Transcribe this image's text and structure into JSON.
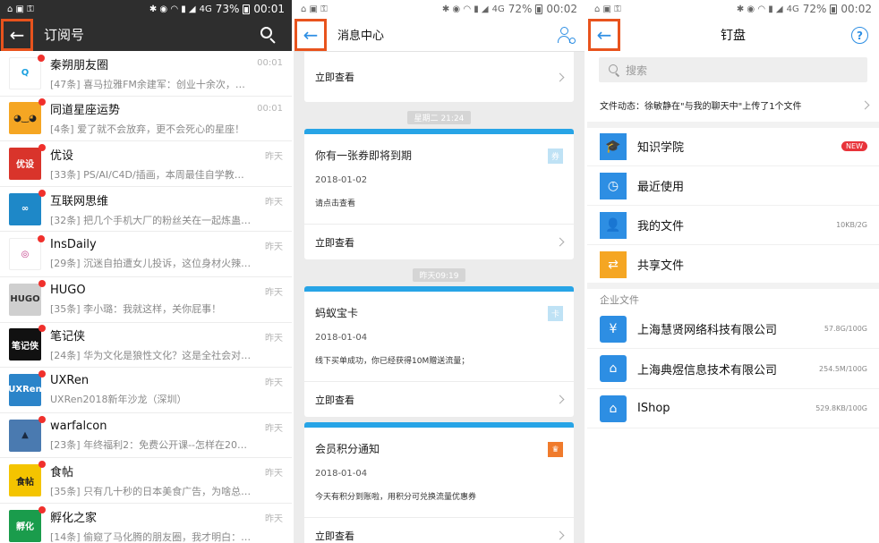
{
  "status_bars": [
    {
      "time": "00:01",
      "battery": "73%",
      "net": "4G"
    },
    {
      "time": "00:02",
      "battery": "72%",
      "net": "4G"
    },
    {
      "time": "00:02",
      "battery": "72%",
      "net": "4G"
    }
  ],
  "subscriptions": {
    "title": "订阅号",
    "items": [
      {
        "name": "秦朔朋友圈",
        "snippet": "[47条] 喜马拉雅FM余建军：创业十余次，在...",
        "time": "00:01",
        "color": "#ffffff",
        "avatar_text": "Q",
        "avatar_fg": "#1aa0e0"
      },
      {
        "name": "同道星座运势",
        "snippet": "[4条] 爱了就不会放弃，更不会死心的星座！",
        "time": "00:01",
        "color": "#f5a623",
        "avatar_text": "◕‿◕",
        "avatar_fg": "#222"
      },
      {
        "name": "优设",
        "snippet": "[33条] PS/AI/C4D/插画，本周最佳自学教程精...",
        "time": "昨天",
        "color": "#d9342b",
        "avatar_text": "优设",
        "avatar_fg": "#fff"
      },
      {
        "name": "互联网思维",
        "snippet": "[32条] 把几个手机大厂的粉丝关在一起炼蛊，...",
        "time": "昨天",
        "color": "#1e88c8",
        "avatar_text": "∞",
        "avatar_fg": "#fff"
      },
      {
        "name": "InsDaily",
        "snippet": "[29条] 沉迷自拍遭女儿投诉，这位身材火辣的...",
        "time": "昨天",
        "color": "#ffffff",
        "avatar_text": "◎",
        "avatar_fg": "#c13584"
      },
      {
        "name": "HUGO",
        "snippet": "[35条] 李小璐：我就这样，关你屁事！",
        "time": "昨天",
        "color": "#cfcfcf",
        "avatar_text": "HUGO",
        "avatar_fg": "#333"
      },
      {
        "name": "笔记侠",
        "snippet": "[24条] 华为文化是狼性文化？这是全社会对我...",
        "time": "昨天",
        "color": "#111111",
        "avatar_text": "笔记侠",
        "avatar_fg": "#fff"
      },
      {
        "name": "UXRen",
        "snippet": "UXRen2018新年沙龙（深圳）",
        "time": "昨天",
        "color": "#2b84c9",
        "avatar_text": "UXRen",
        "avatar_fg": "#fff"
      },
      {
        "name": "warfalcon",
        "snippet": "[23条] 年终福利2：免费公开课--怎样在2018...",
        "time": "昨天",
        "color": "#4a7ab0",
        "avatar_text": "▲",
        "avatar_fg": "#1a2a40"
      },
      {
        "name": "食帖",
        "snippet": "[35条] 只有几十秒的日本美食广告，为啥总能...",
        "time": "昨天",
        "color": "#f4c400",
        "avatar_text": "食帖",
        "avatar_fg": "#222"
      },
      {
        "name": "孵化之家",
        "snippet": "[14条] 偷窥了马化腾的朋友圈，我才明白：马...",
        "time": "昨天",
        "color": "#1a9c4c",
        "avatar_text": "孵化",
        "avatar_fg": "#fff"
      }
    ]
  },
  "message_center": {
    "title": "消息中心",
    "top_link": "立即查看",
    "timestamps": [
      "星期二 21:24",
      "昨天09:19"
    ],
    "cards": [
      {
        "title": "你有一张券即将到期",
        "date": "2018-01-02",
        "desc": "请点击查看",
        "link": "立即查看",
        "icon_color": "#bfe2f5",
        "icon": "券"
      },
      {
        "title": "蚂蚁宝卡",
        "date": "2018-01-04",
        "desc": "线下买单成功，你已经获得10M赠送流量；",
        "link": "立即查看",
        "icon_color": "#bfe2f5",
        "icon": "卡"
      },
      {
        "title": "会员积分通知",
        "date": "2018-01-04",
        "desc": "今天有积分到账啦，用积分可兑换流量优惠券",
        "link": "立即查看",
        "icon_color": "#f07b2c",
        "icon": "♛"
      }
    ]
  },
  "dingpan": {
    "title": "钉盘",
    "search_placeholder": "搜索",
    "file_news": "文件动态：徐敏静在\"与我的聊天中\"上传了1个文件",
    "items": [
      {
        "label": "知识学院",
        "badge": "NEW",
        "right": "",
        "color": "#2d8ee3",
        "icon": "🎓"
      },
      {
        "label": "最近使用",
        "badge": "",
        "right": "",
        "color": "#2d8ee3",
        "icon": "◷"
      },
      {
        "label": "我的文件",
        "badge": "",
        "right": "10KB/2G",
        "color": "#2d8ee3",
        "icon": "👤"
      },
      {
        "label": "共享文件",
        "badge": "",
        "right": "",
        "color": "#f5a623",
        "icon": "⇄"
      }
    ],
    "enterprise_label": "企业文件",
    "enterprise": [
      {
        "label": "上海慧贤网络科技有限公司",
        "right": "57.8G/100G",
        "color": "#2d8ee3",
        "icon": "¥"
      },
      {
        "label": "上海典煜信息技术有限公司",
        "right": "254.5M/100G",
        "color": "#2d8ee3",
        "icon": "⌂"
      },
      {
        "label": "IShop",
        "right": "529.8KB/100G",
        "color": "#2d8ee3",
        "icon": "⌂"
      }
    ]
  },
  "icons": {
    "back": "←",
    "search": "search-icon",
    "help": "?"
  }
}
